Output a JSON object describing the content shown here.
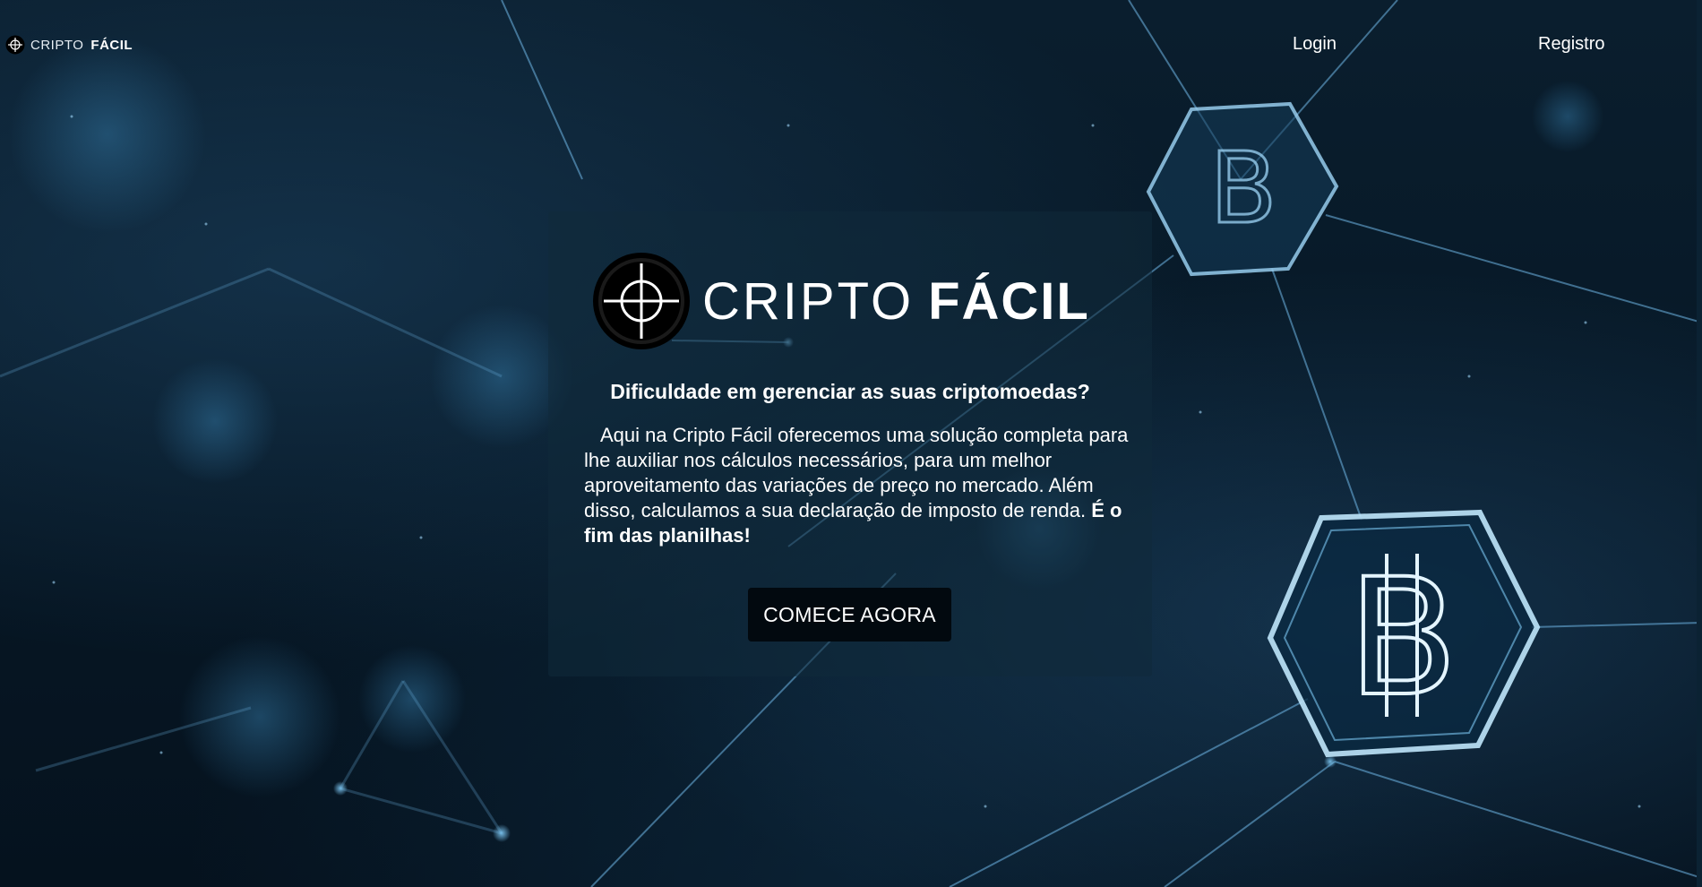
{
  "nav": {
    "brand_light": "CRIPTO",
    "brand_bold": "FÁCIL",
    "login_label": "Login",
    "register_label": "Registro"
  },
  "hero": {
    "logo_light": "CRIPTO",
    "logo_bold": "FÁCIL",
    "heading": "Dificuldade em gerenciar as suas criptomoedas?",
    "body": "Aqui na Cripto Fácil oferecemos uma solução completa para lhe auxiliar nos cálculos necessários, para um melhor aproveitamento das variações de preço no mercado. Além disso, calculamos a sua declaração de imposto de renda.",
    "body_emphasis": "É o fim das planilhas!",
    "cta_label": "COMECE AGORA"
  },
  "icons": {
    "brand_icon": "crosshair-target-icon",
    "background_icons": [
      "bitcoin-hexagon-icon",
      "bitcoin-hexagon-icon"
    ]
  },
  "colors": {
    "background": "#061624",
    "card": "#102a3a",
    "button": "#02090f",
    "text": "#ffffff",
    "network_lines": "#6fb7e6"
  }
}
